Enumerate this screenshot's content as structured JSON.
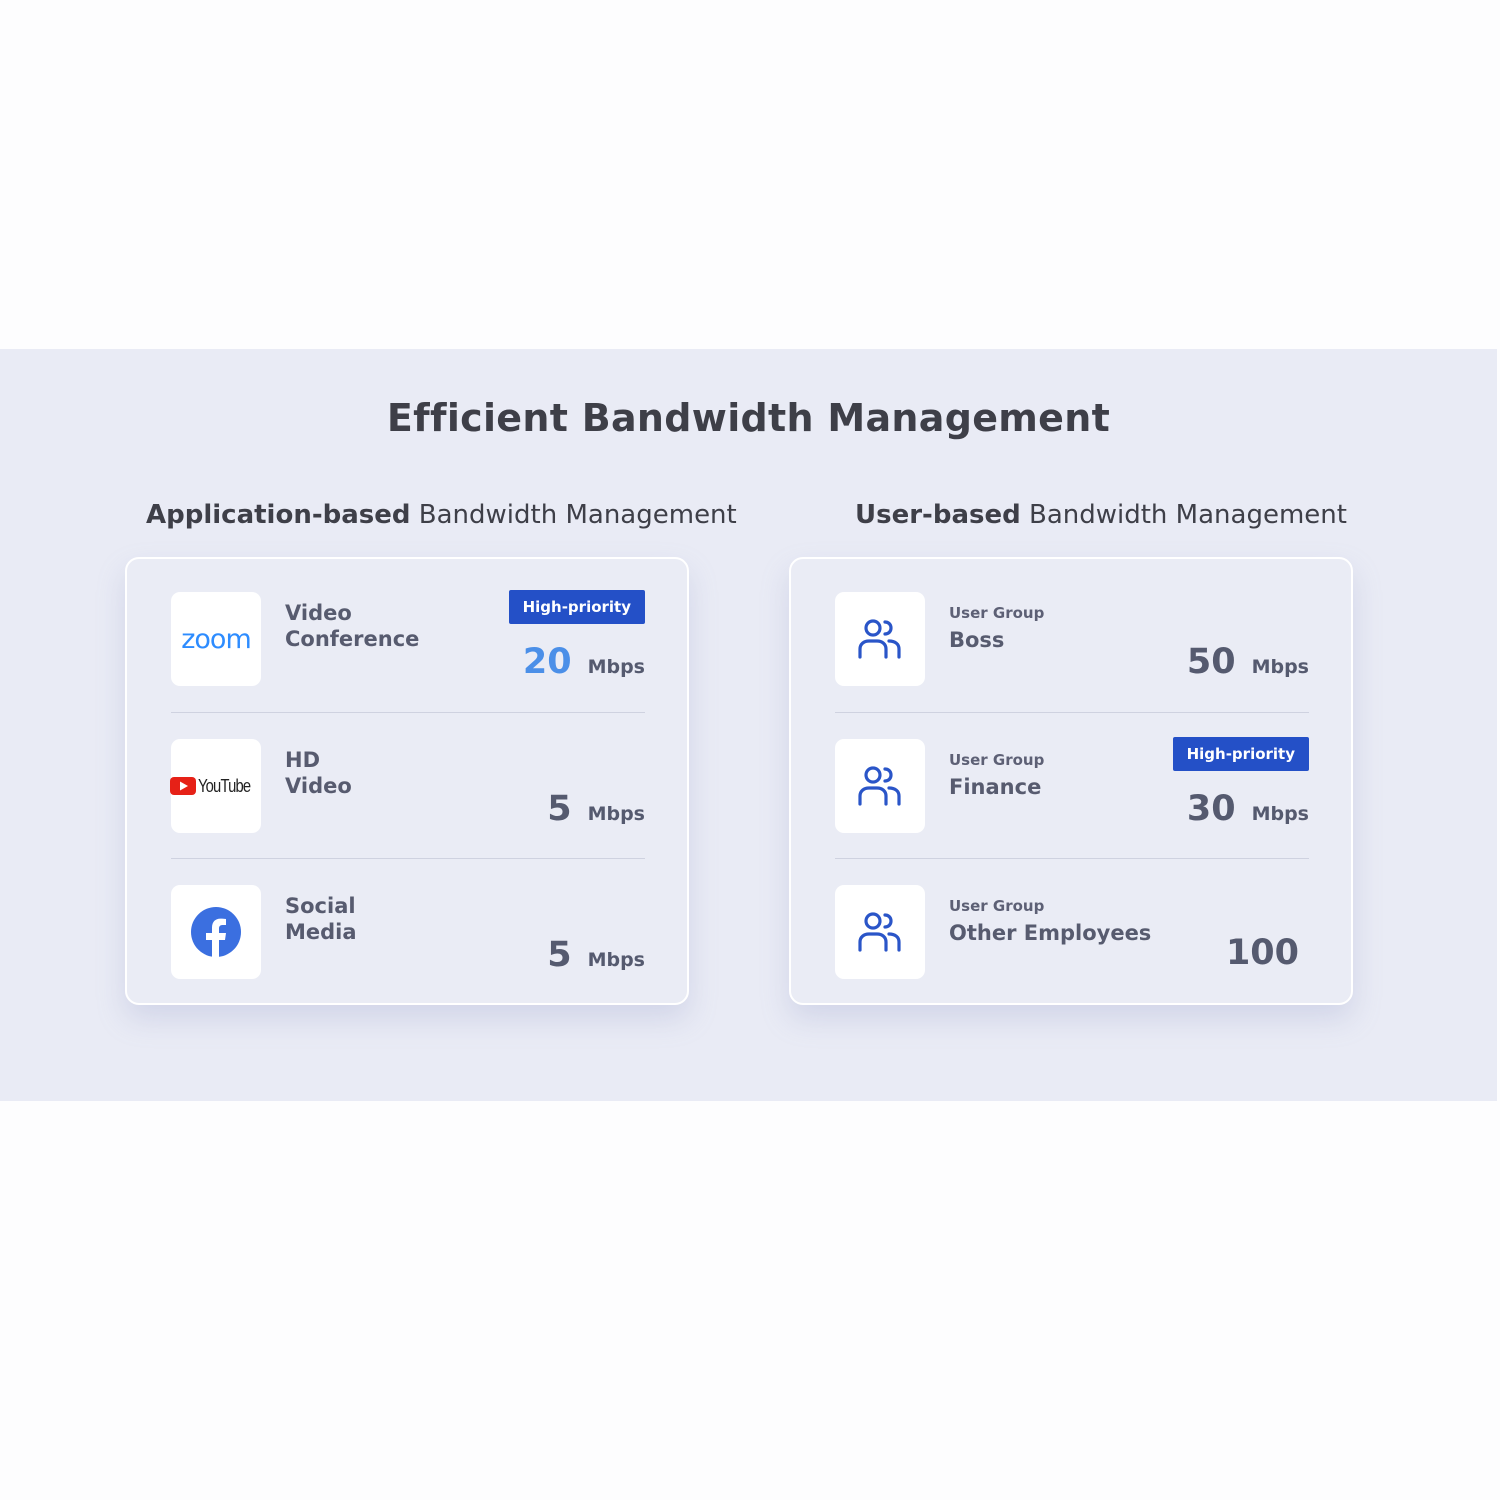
{
  "title": "Efficient Bandwidth Management",
  "sections": {
    "app": {
      "title_bold": "Application-based",
      "title_rest": " Bandwidth Management",
      "rows": [
        {
          "name": "Video\nConference",
          "logo_text": "zoom",
          "badge": "High-priority",
          "value": "20",
          "unit": "Mbps",
          "icon": "zoom-logo"
        },
        {
          "name": "HD\nVideo",
          "logo_text": "YouTube",
          "value": "5",
          "unit": "Mbps",
          "icon": "youtube-logo"
        },
        {
          "name": "Social\nMedia",
          "value": "5",
          "unit": "Mbps",
          "icon": "facebook-logo"
        }
      ]
    },
    "user": {
      "title_bold": "User-based",
      "title_rest": " Bandwidth Management",
      "rows": [
        {
          "caption": "User Group",
          "name": "Boss",
          "value": "50",
          "unit": "Mbps",
          "icon": "users-icon"
        },
        {
          "caption": "User Group",
          "name": "Finance",
          "badge": "High-priority",
          "value": "30",
          "unit": "Mbps",
          "icon": "users-icon"
        },
        {
          "caption": "User Group",
          "name": "Other Employees",
          "value": "100",
          "icon": "users-icon"
        }
      ]
    }
  },
  "colors": {
    "accent": "#2450c7",
    "highlight_value": "#4b8fe8",
    "band_bg": "#e9ebf5",
    "zoom_blue": "#2d8cff",
    "facebook_blue": "#3b6fe0"
  }
}
